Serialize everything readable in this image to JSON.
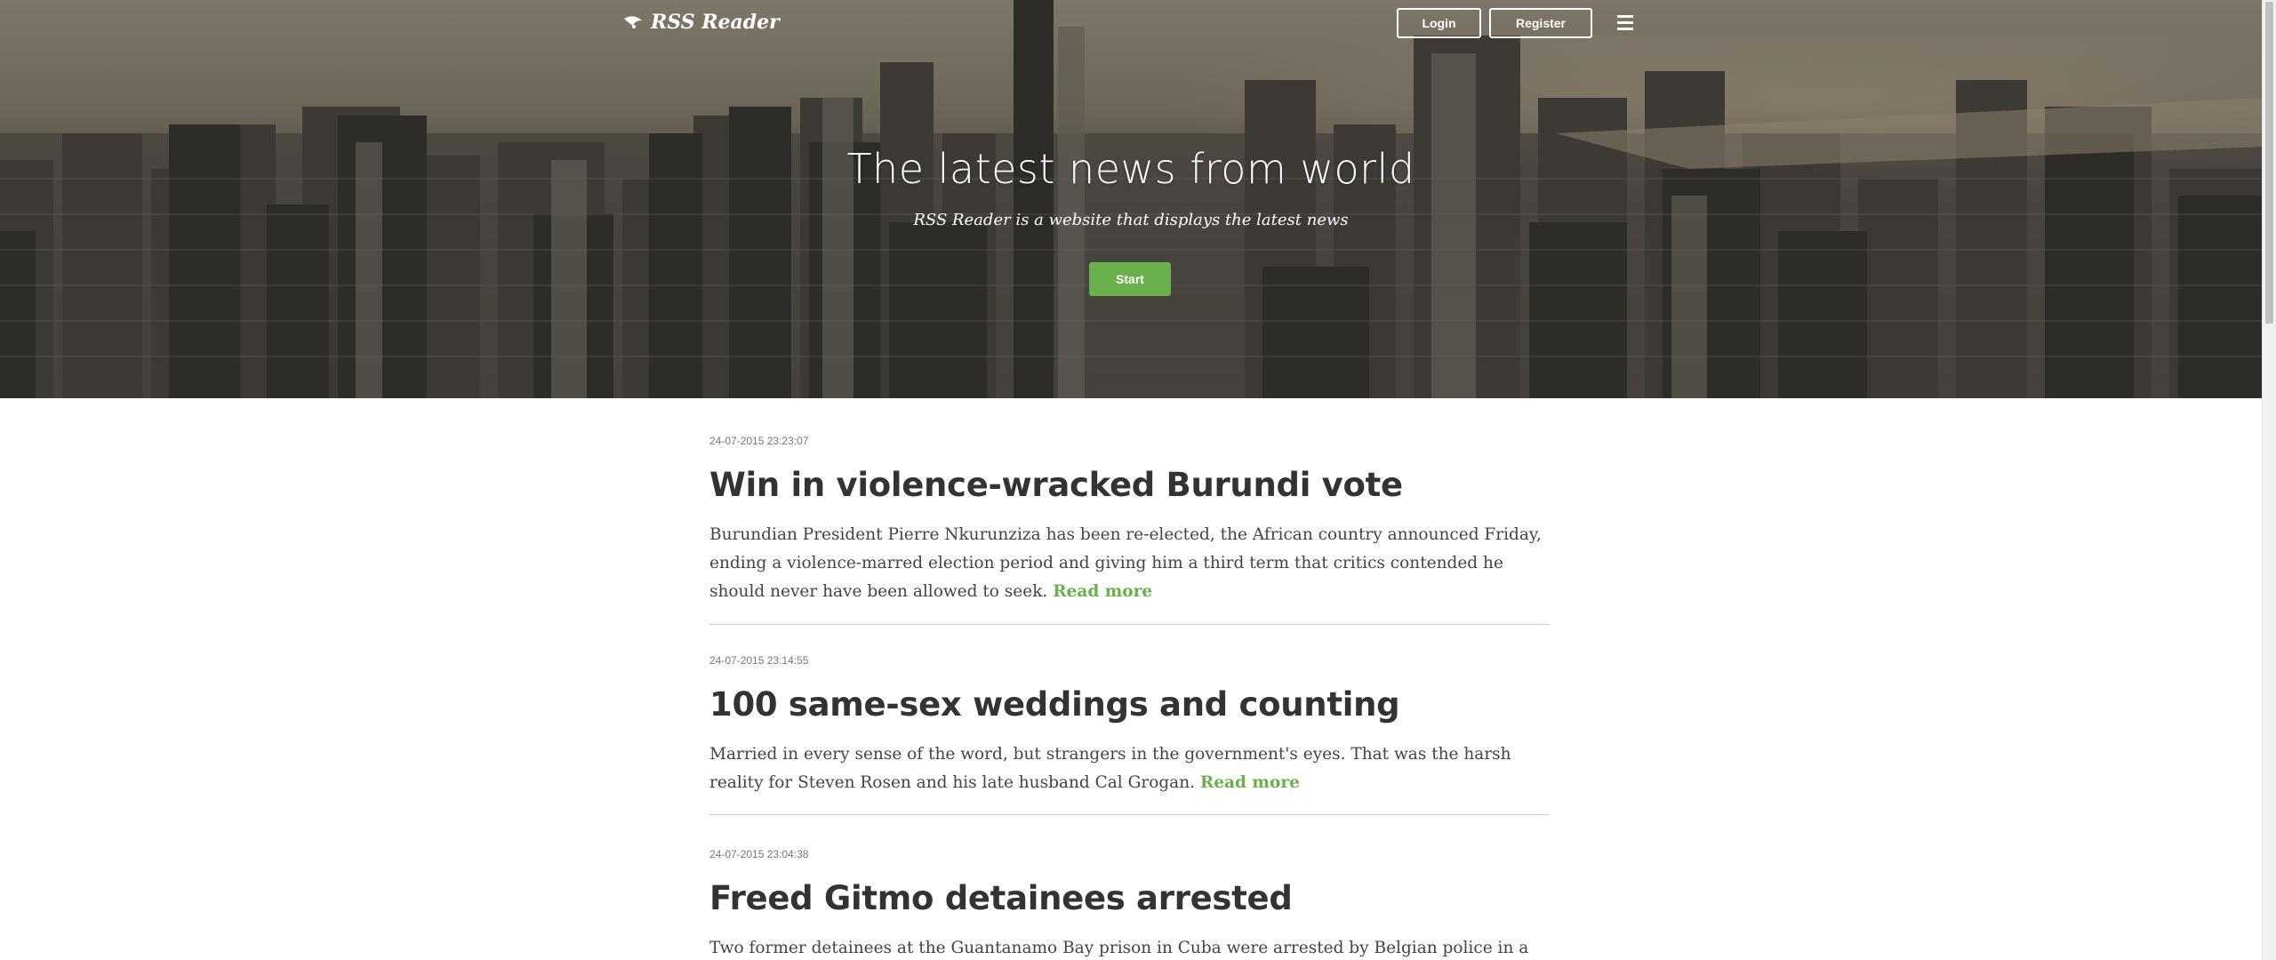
{
  "nav": {
    "brand": "RSS Reader",
    "login_label": "Login",
    "register_label": "Register",
    "menu_icon": "hamburger-icon",
    "logo_icon": "rss-logo-icon"
  },
  "hero": {
    "title": "The latest news from world",
    "subtitle": "RSS Reader is a website that displays the latest news",
    "start_label": "Start"
  },
  "colors": {
    "accent": "#6ab04c",
    "text": "#333333",
    "date": "#777777"
  },
  "articles": [
    {
      "date": "24-07-2015 23:23:07",
      "title": "Win in violence-wracked Burundi vote",
      "summary": "Burundian President Pierre Nkurunziza has been re-elected, the African country announced Friday, ending a violence-marred election period and giving him a third term that critics contended he should never have been allowed to seek.",
      "read_more": "Read more"
    },
    {
      "date": "24-07-2015 23:14:55",
      "title": "100 same-sex weddings and counting",
      "summary": "Married in every sense of the word, but strangers in the government's eyes. That was the harsh reality for Steven Rosen and his late husband Cal Grogan.",
      "read_more": "Read more"
    },
    {
      "date": "24-07-2015 23:04:38",
      "title": "Freed Gitmo detainees arrested",
      "summary": "Two former detainees at the Guantanamo Bay prison in Cuba were arrested by Belgian police in a"
    }
  ]
}
